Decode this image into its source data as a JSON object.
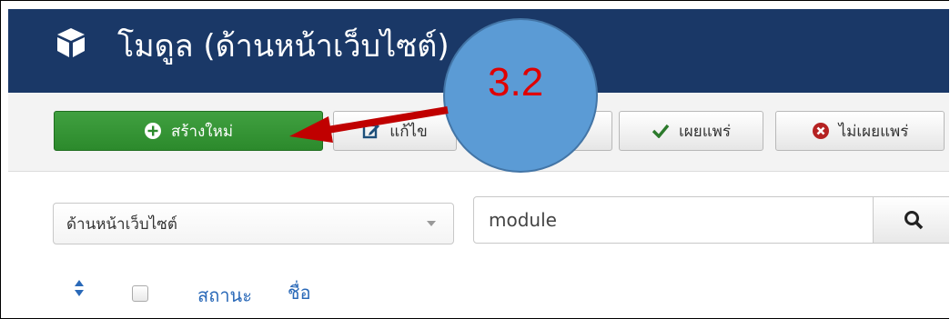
{
  "header": {
    "title": "โมดูล (ด้านหน้าเว็บไซต์)",
    "icon": "cube-icon",
    "bg": "#1a3867"
  },
  "toolbar": {
    "new_label": "สร้างใหม่",
    "edit_label": "แก้ไข",
    "publish_label": "เผยแพร่",
    "unpublish_label": "ไม่เผยแพร่"
  },
  "filters": {
    "client_select": "ด้านหน้าเว็บไซต์",
    "search_value": "module"
  },
  "table": {
    "status_header": "สถานะ",
    "name_header": "ชื่อ"
  },
  "annotation": {
    "step_label": "3.2",
    "circle_color": "#5b9bd5",
    "arrow_color": "#c00000"
  }
}
